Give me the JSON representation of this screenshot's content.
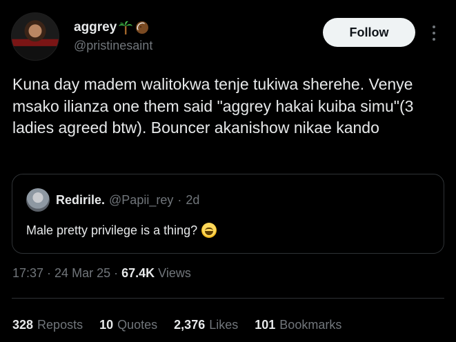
{
  "author": {
    "display_name": "aggrey",
    "handle": "@pristinesaint",
    "name_emojis": [
      "palm-tree-icon",
      "coconut-icon"
    ]
  },
  "follow_button": {
    "label": "Follow"
  },
  "tweet": {
    "text": "Kuna day madem walitokwa tenje tukiwa sherehe. Venye msako ilianza one them said \"aggrey hakai kuiba simu\"(3 ladies agreed btw). Bouncer akanishow nikae kando"
  },
  "quoted_tweet": {
    "display_name": "Redirile.",
    "handle": "@Papii_rey",
    "separator": "·",
    "time": "2d",
    "text": "Male pretty privilege is a thing?",
    "emoji": "grinning-sweat-icon"
  },
  "meta": {
    "time": "17:37",
    "sep1": "·",
    "date": "24 Mar 25",
    "sep2": "·",
    "views_count": "67.4K",
    "views_label": "Views"
  },
  "stats": [
    {
      "count": "328",
      "label": "Reposts"
    },
    {
      "count": "10",
      "label": "Quotes"
    },
    {
      "count": "2,376",
      "label": "Likes"
    },
    {
      "count": "101",
      "label": "Bookmarks"
    }
  ],
  "colors": {
    "background": "#000000",
    "text": "#e7e9ea",
    "secondary_text": "#71767b",
    "border": "#2f3336",
    "follow_bg": "#eff3f4"
  }
}
